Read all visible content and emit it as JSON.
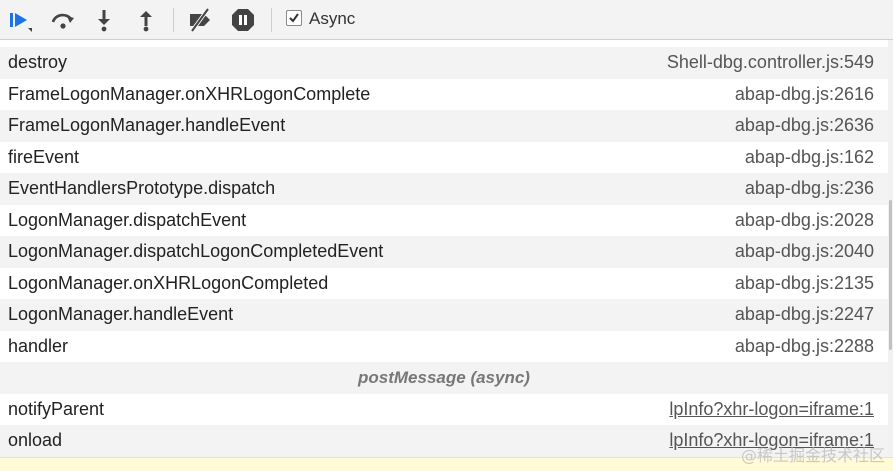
{
  "toolbar": {
    "resume_icon": "resume-icon",
    "step_over_icon": "step-over-icon",
    "step_into_icon": "step-into-icon",
    "step_out_icon": "step-out-icon",
    "deactivate_breakpoints_icon": "deactivate-breakpoints-icon",
    "pause_on_exceptions_icon": "pause-on-exceptions-icon",
    "async_label": "Async",
    "async_checked": true,
    "accent_color": "#1a73e8"
  },
  "frames": [
    {
      "fn": "destroy",
      "loc": "Shell-dbg.controller.js:549"
    },
    {
      "fn": "FrameLogonManager.onXHRLogonComplete",
      "loc": "abap-dbg.js:2616"
    },
    {
      "fn": "FrameLogonManager.handleEvent",
      "loc": "abap-dbg.js:2636"
    },
    {
      "fn": "fireEvent",
      "loc": "abap-dbg.js:162"
    },
    {
      "fn": "EventHandlersPrototype.dispatch",
      "loc": "abap-dbg.js:236"
    },
    {
      "fn": "LogonManager.dispatchEvent",
      "loc": "abap-dbg.js:2028"
    },
    {
      "fn": "LogonManager.dispatchLogonCompletedEvent",
      "loc": "abap-dbg.js:2040"
    },
    {
      "fn": "LogonManager.onXHRLogonCompleted",
      "loc": "abap-dbg.js:2135"
    },
    {
      "fn": "LogonManager.handleEvent",
      "loc": "abap-dbg.js:2247"
    },
    {
      "fn": "handler",
      "loc": "abap-dbg.js:2288"
    }
  ],
  "async_separator": "postMessage (async)",
  "async_frames": [
    {
      "fn": "notifyParent",
      "loc": "lpInfo?xhr-logon=iframe:1"
    },
    {
      "fn": "onload",
      "loc": "lpInfo?xhr-logon=iframe:1"
    }
  ],
  "watermark": "@稀土掘金技术社区"
}
